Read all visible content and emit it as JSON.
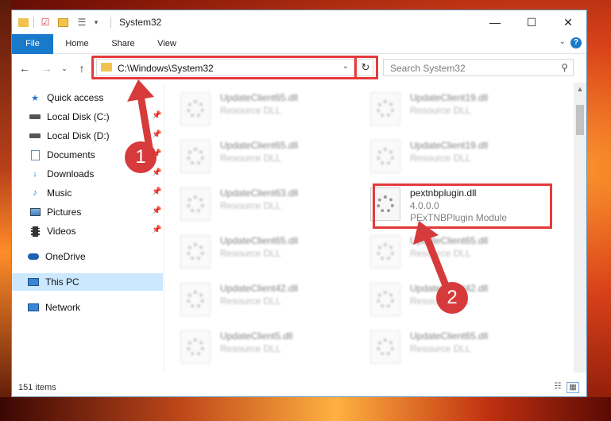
{
  "window": {
    "title": "System32",
    "minimize": "—",
    "maximize": "☐",
    "close": "✕"
  },
  "ribbon": {
    "tabs": [
      "File",
      "Home",
      "Share",
      "View"
    ],
    "help": "?"
  },
  "nav": {
    "address": "C:\\Windows\\System32",
    "search_placeholder": "Search System32"
  },
  "sidebar": {
    "items": [
      {
        "label": "Quick access",
        "icon": "star-icon",
        "pinned": false
      },
      {
        "label": "Local Disk (C:)",
        "icon": "drive-icon",
        "pinned": true
      },
      {
        "label": "Local Disk (D:)",
        "icon": "drive-icon",
        "pinned": true
      },
      {
        "label": "Documents",
        "icon": "documents-icon",
        "pinned": true
      },
      {
        "label": "Downloads",
        "icon": "download-icon",
        "pinned": true
      },
      {
        "label": "Music",
        "icon": "music-icon",
        "pinned": true
      },
      {
        "label": "Pictures",
        "icon": "pictures-icon",
        "pinned": true
      },
      {
        "label": "Videos",
        "icon": "videos-icon",
        "pinned": true
      },
      {
        "label": "OneDrive",
        "icon": "cloud-icon",
        "pinned": false
      },
      {
        "label": "This PC",
        "icon": "computer-icon",
        "pinned": false,
        "selected": true
      },
      {
        "label": "Network",
        "icon": "network-icon",
        "pinned": false
      }
    ]
  },
  "files": {
    "left": [
      {
        "name": "UpdateClient65.dll",
        "desc": "Resource DLL"
      },
      {
        "name": "UpdateClient65.dll",
        "desc": "Resource DLL"
      },
      {
        "name": "UpdateClient63.dll",
        "desc": "Resource DLL"
      },
      {
        "name": "UpdateClient65.dll",
        "desc": "Resource DLL"
      },
      {
        "name": "UpdateClient42.dll",
        "desc": "Resource DLL"
      },
      {
        "name": "UpdateClient5.dll",
        "desc": "Resource DLL"
      }
    ],
    "right": [
      {
        "name": "UpdateClient19.dll",
        "desc": "Resource DLL"
      },
      {
        "name": "UpdateClient19.dll",
        "desc": "Resource DLL"
      },
      {
        "name": "pextnbplugin.dll",
        "version": "4.0.0.0",
        "desc": "PExTNBPlugin Module",
        "highlight": true
      },
      {
        "name": "UpdateClient65.dll",
        "desc": "Resource DLL"
      },
      {
        "name": "UpdateClient42.dll",
        "desc": "Resource DLL"
      },
      {
        "name": "UpdateClient65.dll",
        "desc": "Resource DLL"
      }
    ]
  },
  "status": {
    "item_count": "151 items"
  },
  "callouts": {
    "step1": "1",
    "step2": "2",
    "color": "#e53a3a"
  }
}
